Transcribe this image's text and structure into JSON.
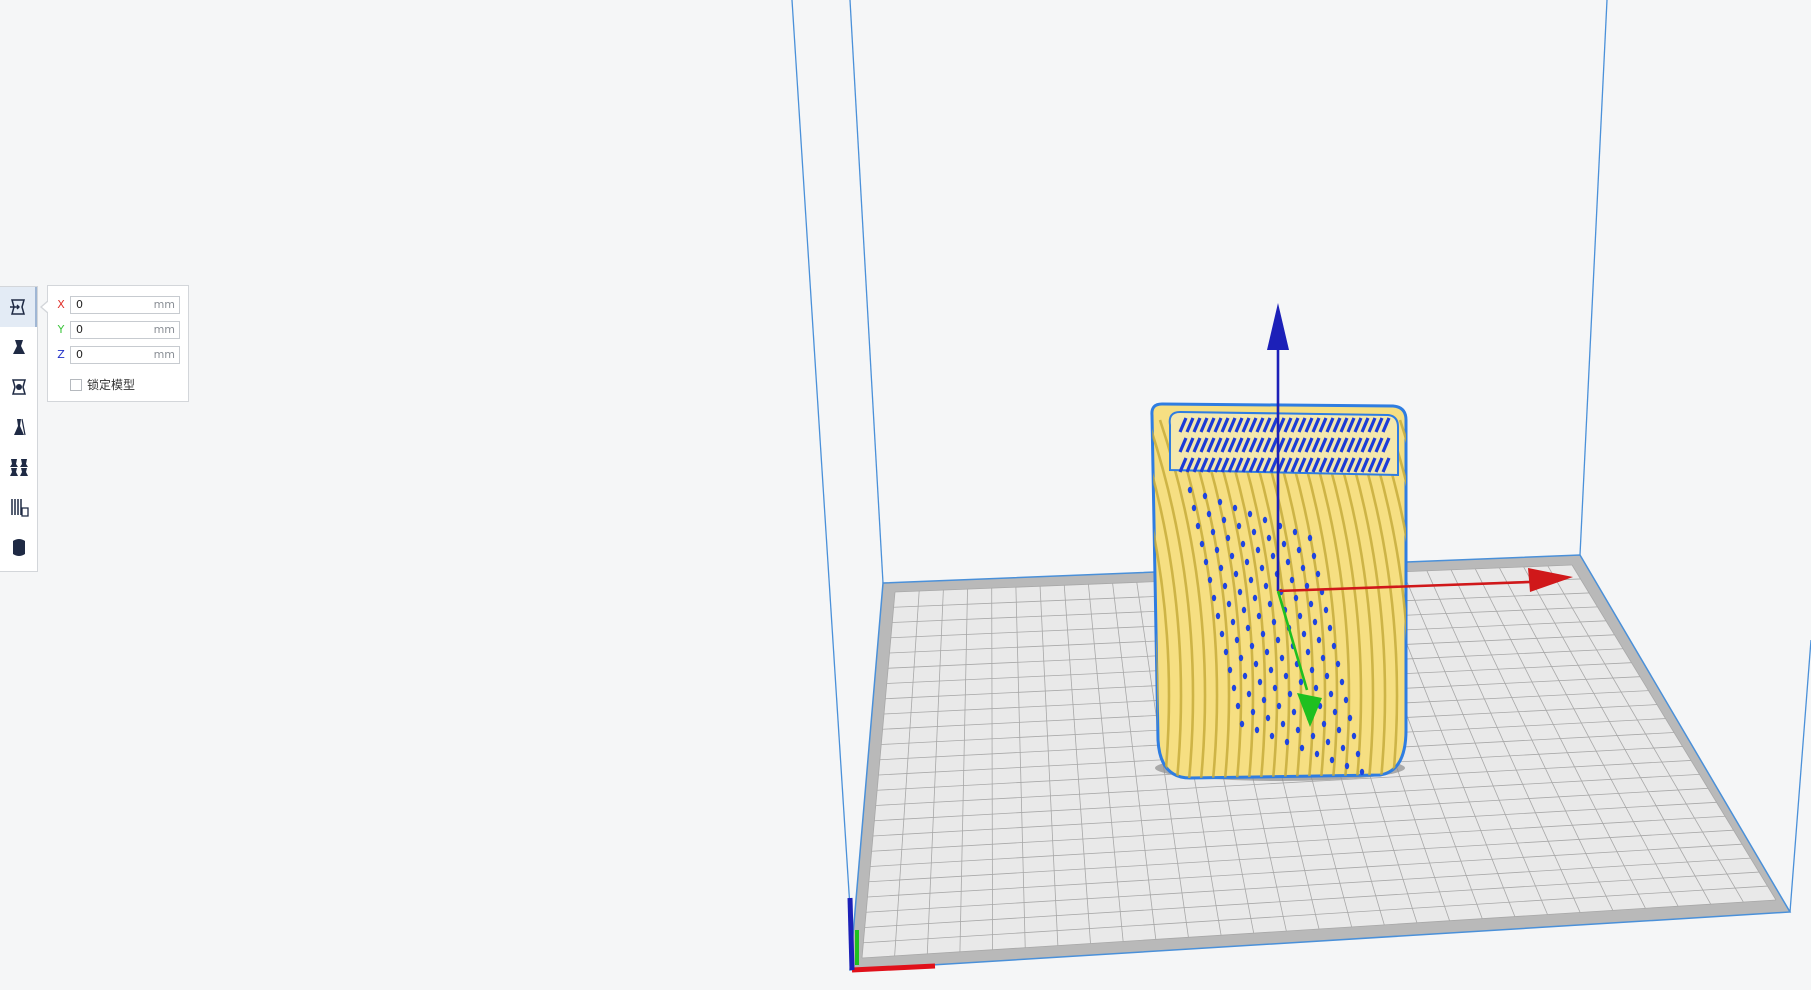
{
  "toolbar": {
    "tools": [
      {
        "name": "move",
        "icon": "move-icon",
        "active": true
      },
      {
        "name": "scale",
        "icon": "scale-icon",
        "active": false
      },
      {
        "name": "rotate",
        "icon": "rotate-icon",
        "active": false
      },
      {
        "name": "mirror",
        "icon": "mirror-icon",
        "active": false
      },
      {
        "name": "per-model-settings",
        "icon": "per-model-settings-icon",
        "active": false
      },
      {
        "name": "support-blocker",
        "icon": "support-blocker-icon",
        "active": false
      },
      {
        "name": "cylinder",
        "icon": "cylinder-icon",
        "active": false
      }
    ]
  },
  "move_panel": {
    "x": {
      "label": "X",
      "value": "0",
      "unit": "mm",
      "color": "#e0312b"
    },
    "y": {
      "label": "Y",
      "value": "0",
      "unit": "mm",
      "color": "#3ac43a"
    },
    "z": {
      "label": "Z",
      "value": "0",
      "unit": "mm",
      "color": "#2131c8"
    },
    "lock_model": {
      "label": "锁定模型",
      "checked": false
    }
  },
  "scene": {
    "model_color": "#f5e27e",
    "model_outline_color": "#2f7de1",
    "build_volume_color": "#4a90d9",
    "axis_colors": {
      "x": "#d0181a",
      "y": "#1fc01f",
      "z": "#1c20b8"
    }
  }
}
